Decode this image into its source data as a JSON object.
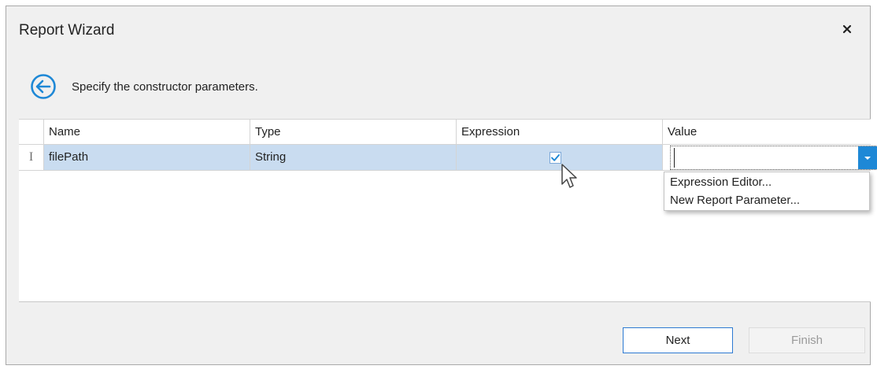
{
  "window": {
    "title": "Report Wizard",
    "close_icon": "close-icon"
  },
  "header": {
    "back_icon": "back-arrow-icon",
    "instruction": "Specify the constructor parameters."
  },
  "grid": {
    "columns": [
      "Name",
      "Type",
      "Expression",
      "Value"
    ],
    "rows": [
      {
        "indicator": "I",
        "name": "filePath",
        "type": "String",
        "expression_checked": true,
        "value": ""
      }
    ]
  },
  "value_dropdown": {
    "items": [
      "Expression Editor...",
      "New Report Parameter..."
    ]
  },
  "footer": {
    "next_label": "Next",
    "finish_label": "Finish"
  },
  "colors": {
    "accent": "#1e88d6",
    "selected_row": "#c9dcf0",
    "dialog_background": "#f0f0f0"
  }
}
